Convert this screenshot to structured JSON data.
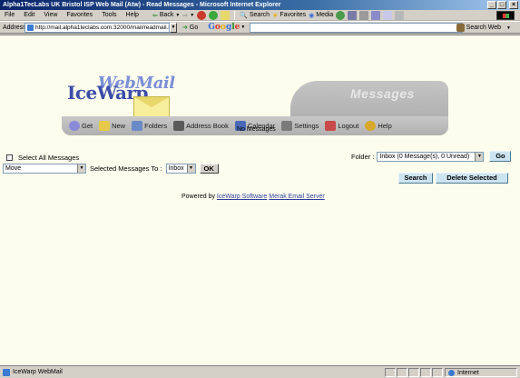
{
  "window": {
    "title": "Alpha1TecLabs UK Bristol ISP Web Mail (Atw) - Read Messages - Microsoft Internet Explorer",
    "buttons": [
      "_",
      "□",
      "×"
    ]
  },
  "menu": {
    "items": [
      "File",
      "Edit",
      "View",
      "Favorites",
      "Tools",
      "Help"
    ],
    "toolbar": {
      "back": "Back",
      "search": "Search",
      "favorites": "Favorites",
      "media": "Media"
    }
  },
  "address": {
    "label": "Address",
    "url": "http://mail.alpha1teclabs.com:32000/mail/readmail.html",
    "go": "Go",
    "google": [
      "G",
      "o",
      "o",
      "g",
      "l",
      "e"
    ],
    "search_web": "Search Web"
  },
  "banner": {
    "logo_ice": "IceWarp",
    "logo_webmail": "WebMail",
    "section": "Messages",
    "nav": [
      {
        "label": "Get",
        "icon": "get-mail-icon",
        "color": "#8a8ad8"
      },
      {
        "label": "New",
        "icon": "new-mail-icon",
        "color": "#e8c84a"
      },
      {
        "label": "Folders",
        "icon": "folders-icon",
        "color": "#6a8ac8"
      },
      {
        "label": "Address Book",
        "icon": "address-book-icon",
        "color": "#5a5a5a"
      },
      {
        "label": "Calendar",
        "icon": "calendar-icon",
        "color": "#4a6ab8"
      },
      {
        "label": "Settings",
        "icon": "settings-icon",
        "color": "#7a7a7a"
      },
      {
        "label": "Logout",
        "icon": "logout-icon",
        "color": "#c84a4a"
      },
      {
        "label": "Help",
        "icon": "help-icon",
        "color": "#d8a82a"
      }
    ]
  },
  "main": {
    "empty_text": "No Messages",
    "select_all": "Select All Messages",
    "folder_label": "Folder :",
    "folder_value": "Inbox (0 Message(s), 0 Unread)",
    "go_button": "Go",
    "action_value": "Move",
    "selected_to": "Selected Messages To :",
    "target_folder": "Inbox",
    "ok_button": "OK",
    "search_button": "Search",
    "delete_button": "Delete Selected",
    "powered_prefix": "Powered by",
    "powered_link1": "IceWarp Software",
    "powered_link2": "Merak Email Server"
  },
  "status": {
    "text": "IceWarp WebMail",
    "zone": "Internet"
  },
  "colors": {
    "content_bg": "#fdfded",
    "button_bg": "#cce4f0",
    "link": "#2b3f9e",
    "title_bar": "#0a246a"
  }
}
